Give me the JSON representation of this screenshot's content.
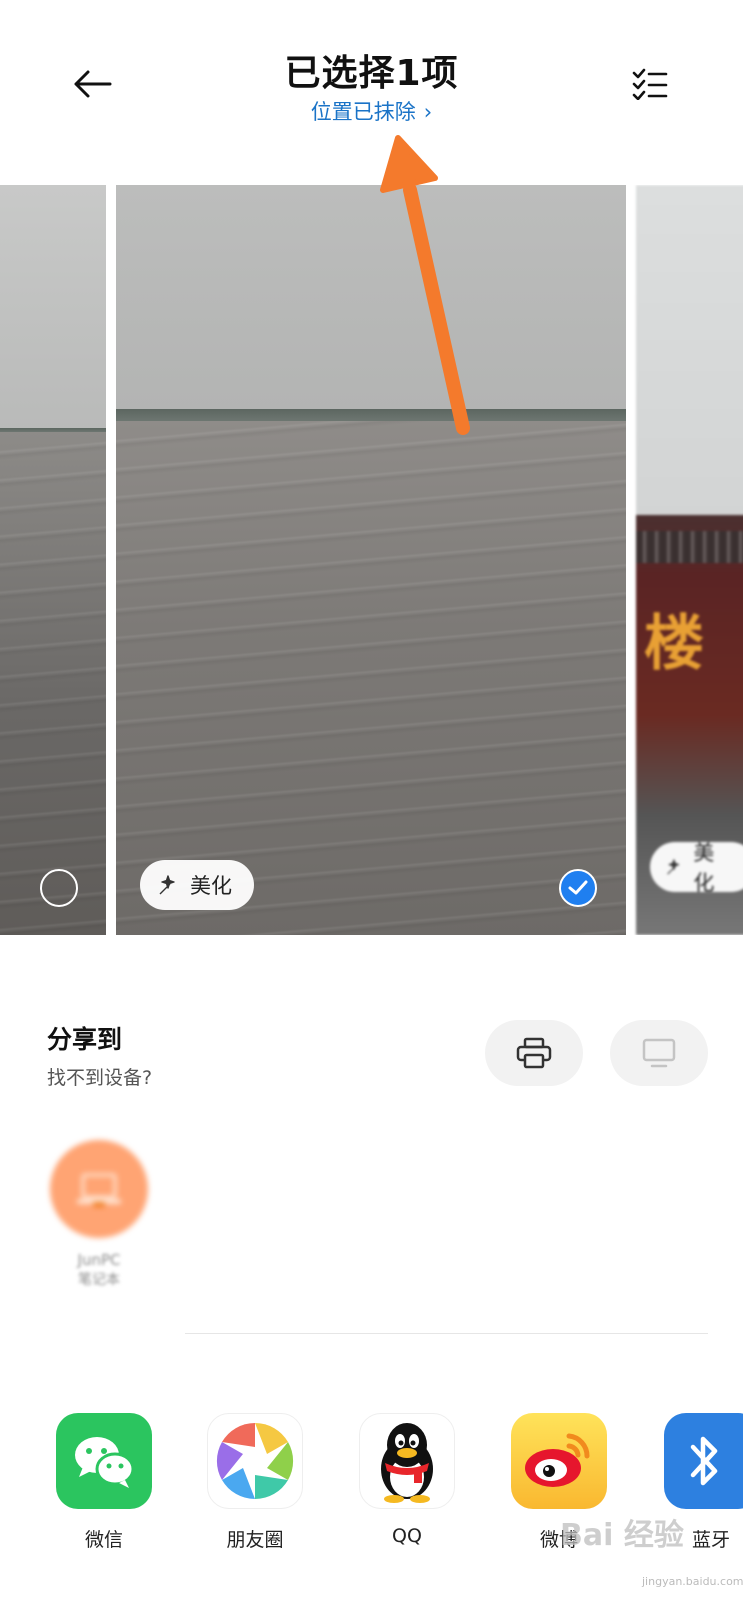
{
  "header": {
    "title": "已选择1项",
    "subtitle": "位置已抹除",
    "subtitle_chevron": "›"
  },
  "photos": {
    "main_beautify_label": "美化",
    "next_beautify_label": "美化",
    "main_selected": true,
    "prev_selected": false
  },
  "share": {
    "title": "分享到",
    "subtitle": "找不到设备?",
    "device": {
      "name": "JunPC",
      "type": "笔记本"
    }
  },
  "apps": [
    {
      "label": "微信"
    },
    {
      "label": "朋友圈"
    },
    {
      "label": "QQ"
    },
    {
      "label": "微博"
    },
    {
      "label": "蓝牙"
    }
  ],
  "watermark": {
    "brand": "Bai 经验",
    "url": "jingyan.baidu.com"
  },
  "colors": {
    "accent_blue": "#1a73c7",
    "check_blue": "#1f7ff0",
    "annotation_arrow": "#f47a2c",
    "wechat_green": "#2bc55f",
    "bluetooth_blue": "#2d80e0",
    "device_orange": "#ffa473"
  }
}
